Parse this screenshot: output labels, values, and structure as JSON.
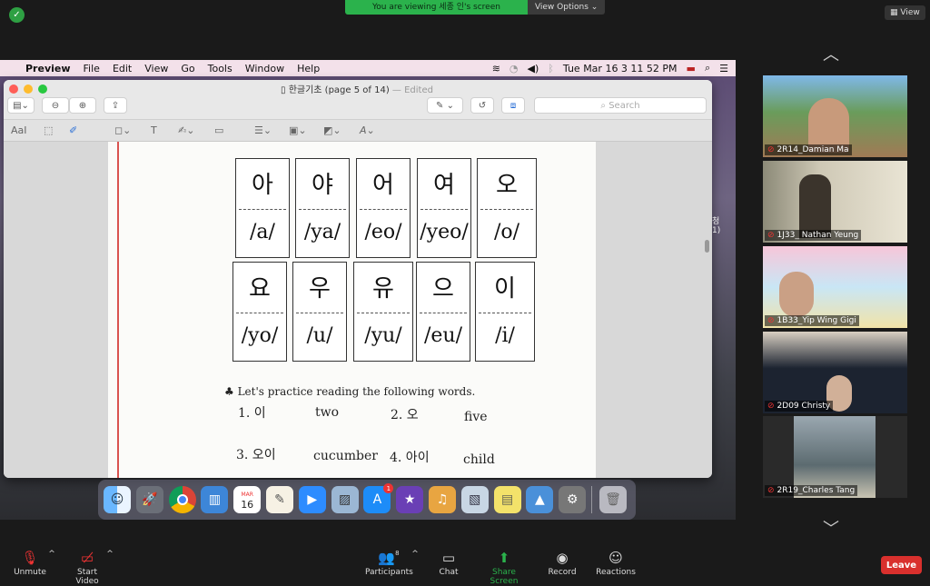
{
  "zoom": {
    "share_banner": "You are viewing 세종 인's screen",
    "view_options": "View Options ⌄",
    "view_button": "View",
    "leave": "Leave"
  },
  "menubar": {
    "apple": "",
    "app": "Preview",
    "items": [
      "File",
      "Edit",
      "View",
      "Go",
      "Tools",
      "Window",
      "Help"
    ],
    "clock": "Tue Mar 16  3 11 52 PM"
  },
  "preview": {
    "title": "한글기초 (page 5 of 14)",
    "edited": "— Edited",
    "search_placeholder": "Search",
    "aa_label": "AaI"
  },
  "document": {
    "row1": [
      {
        "k": "아",
        "r": "/a/"
      },
      {
        "k": "야",
        "r": "/ya/"
      },
      {
        "k": "어",
        "r": "/eo/"
      },
      {
        "k": "여",
        "r": "/yeo/"
      },
      {
        "k": "오",
        "r": "/o/"
      }
    ],
    "row2": [
      {
        "k": "요",
        "r": "/yo/"
      },
      {
        "k": "우",
        "r": "/u/"
      },
      {
        "k": "유",
        "r": "/yu/"
      },
      {
        "k": "으",
        "r": "/eu/"
      },
      {
        "k": "이",
        "r": "/i/"
      }
    ],
    "instruction": "♣ Let's practice reading the following words.",
    "words": {
      "w1": "1. 이",
      "w1_en": "two",
      "w2": "2. 오",
      "w2_en": "five",
      "w3": "3. 오이",
      "w3_en": "cucumber",
      "w4": "4. 아이",
      "w4_en": "child"
    }
  },
  "desktop_edge_text": "청\n1)",
  "dock": {
    "calendar_month": "MAR",
    "calendar_day": "16",
    "appstore_badge": "1"
  },
  "participants_tiles": [
    {
      "name": "2R14_Damian Ma"
    },
    {
      "name": "1J33_ Nathan Yeung"
    },
    {
      "name": "1B33_Yip Wing Gigi"
    },
    {
      "name": "2D09 Christy"
    },
    {
      "name": "2R19_Charles Tang"
    }
  ],
  "bottom_bar": {
    "unmute": "Unmute",
    "start_video": "Start Video",
    "participants": "Participants",
    "participants_count": "8",
    "chat": "Chat",
    "share_screen": "Share Screen",
    "record": "Record",
    "reactions": "Reactions"
  }
}
